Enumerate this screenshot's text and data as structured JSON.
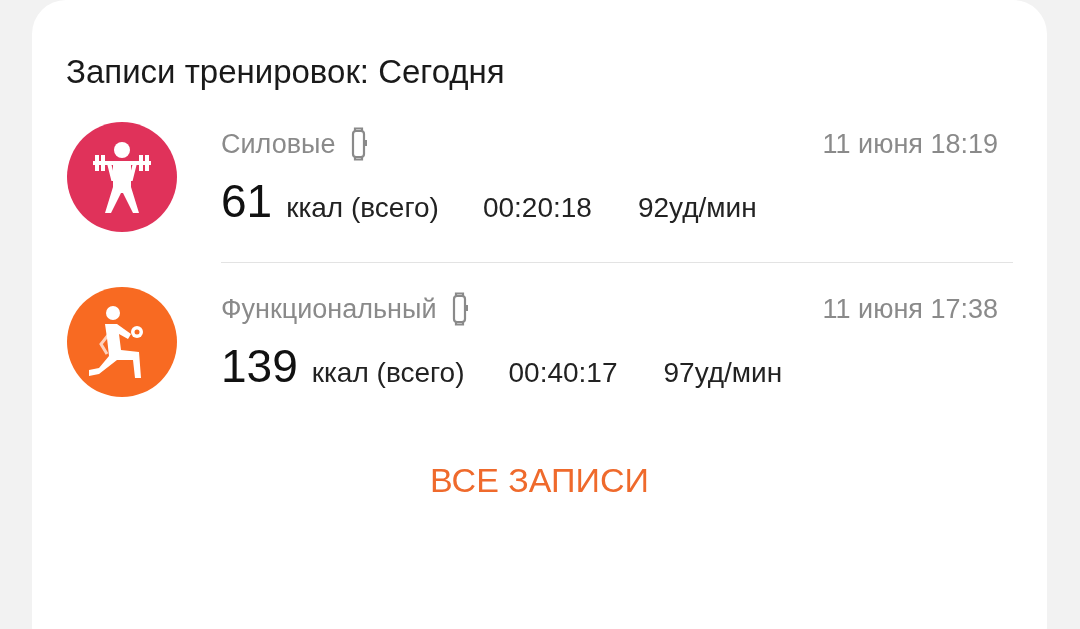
{
  "card": {
    "title": "Записи тренировок: Сегодня",
    "workouts": [
      {
        "kind": "strength",
        "color": "#e0325a",
        "name": "Силовые",
        "date": "11 июня 18:19",
        "calories": "61",
        "calories_unit": "ккал (всего)",
        "duration": "00:20:18",
        "heart_rate": "92уд/мин"
      },
      {
        "kind": "functional",
        "color": "#f86a22",
        "name": "Функциональный",
        "date": "11 июня 17:38",
        "calories": "139",
        "calories_unit": "ккал (всего)",
        "duration": "00:40:17",
        "heart_rate": "97уд/мин"
      }
    ],
    "button": "ВСЕ ЗАПИСИ"
  }
}
